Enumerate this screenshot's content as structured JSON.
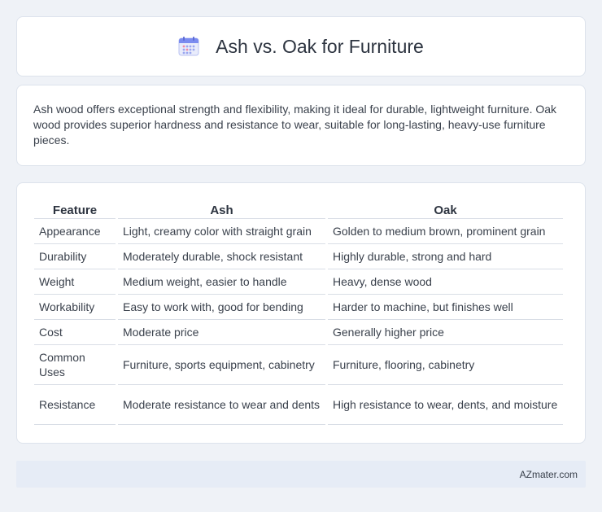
{
  "header": {
    "icon": "calendar-icon",
    "title": "Ash vs. Oak for Furniture"
  },
  "summary": {
    "text": "Ash wood offers exceptional strength and flexibility, making it ideal for durable, lightweight furniture. Oak wood provides superior hardness and resistance to wear, suitable for long-lasting, heavy-use furniture pieces."
  },
  "table": {
    "headers": [
      "Feature",
      "Ash",
      "Oak"
    ],
    "rows": [
      [
        "Appearance",
        "Light, creamy color with straight grain",
        "Golden to medium brown, prominent grain"
      ],
      [
        "Durability",
        "Moderately durable, shock resistant",
        "Highly durable, strong and hard"
      ],
      [
        "Weight",
        "Medium weight, easier to handle",
        "Heavy, dense wood"
      ],
      [
        "Workability",
        "Easy to work with, good for bending",
        "Harder to machine, but finishes well"
      ],
      [
        "Cost",
        "Moderate price",
        "Generally higher price"
      ],
      [
        "Common Uses",
        "Furniture, sports equipment, cabinetry",
        "Furniture, flooring, cabinetry"
      ],
      [
        "Resistance",
        "Moderate resistance to wear and dents",
        "High resistance to wear, dents, and moisture"
      ]
    ]
  },
  "footer": {
    "source": "AZmater.com"
  },
  "colors": {
    "background": "#eff2f7",
    "card": "#ffffff",
    "footer_bg": "#e6ecf6",
    "icon_accent": "#7b8cf0"
  }
}
